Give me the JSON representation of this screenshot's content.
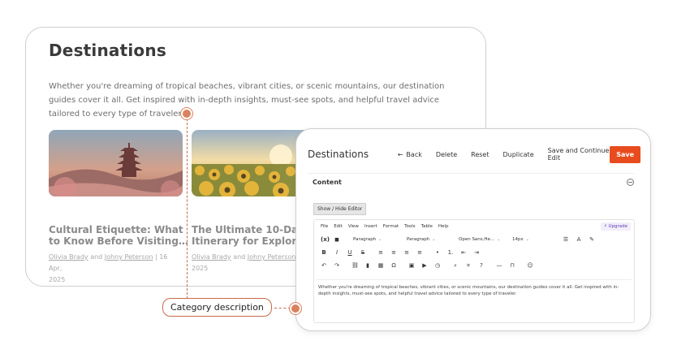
{
  "front": {
    "title": "Destinations",
    "description": "Whether you're dreaming of tropical beaches, vibrant cities, or scenic mountains, our destination guides cover it all. Get inspired with in-depth insights, must-see spots, and helpful travel advice tailored to every type of traveler.",
    "posts": [
      {
        "title_line1": "Cultural Etiquette: What",
        "title_line2": "to Know Before Visiting…",
        "author1": "Olivia Brady",
        "and": "and",
        "author2": "Johny Peterson",
        "date_part1": "| 16 Apr,",
        "date_part2": "2025"
      },
      {
        "title_line1": "The Ultimate 10-Day",
        "title_line2": "Itinerary for Exploring",
        "author1": "Olivia Brady",
        "and": "and",
        "author2": "Johny Peterson",
        "date_part1": "| ",
        "date_part2": "2025"
      }
    ]
  },
  "admin": {
    "title": "Destinations",
    "back_label": "Back",
    "delete_label": "Delete",
    "reset_label": "Reset",
    "duplicate_label": "Duplicate",
    "save_continue_label": "Save and Continue Edit",
    "save_label": "Save",
    "content_label": "Content",
    "toggle_editor_label": "Show / Hide Editor",
    "menu": [
      "File",
      "Edit",
      "View",
      "Insert",
      "Format",
      "Tools",
      "Table",
      "Help"
    ],
    "upgrade_label": "Upgrade",
    "toolbar": {
      "block1": "Paragraph",
      "block2": "Paragraph",
      "font": "Open Sans,He...",
      "size": "14px"
    },
    "body_text": "Whether you're dreaming of tropical beaches, vibrant cities, or scenic mountains, our destination guides cover it all. Get inspired with in-depth insights, must-see spots, and helpful travel advice tailored to every type of traveler."
  },
  "callout": {
    "label": "Category description"
  },
  "colors": {
    "accent": "#e84c1e",
    "callout": "#d9825f"
  }
}
